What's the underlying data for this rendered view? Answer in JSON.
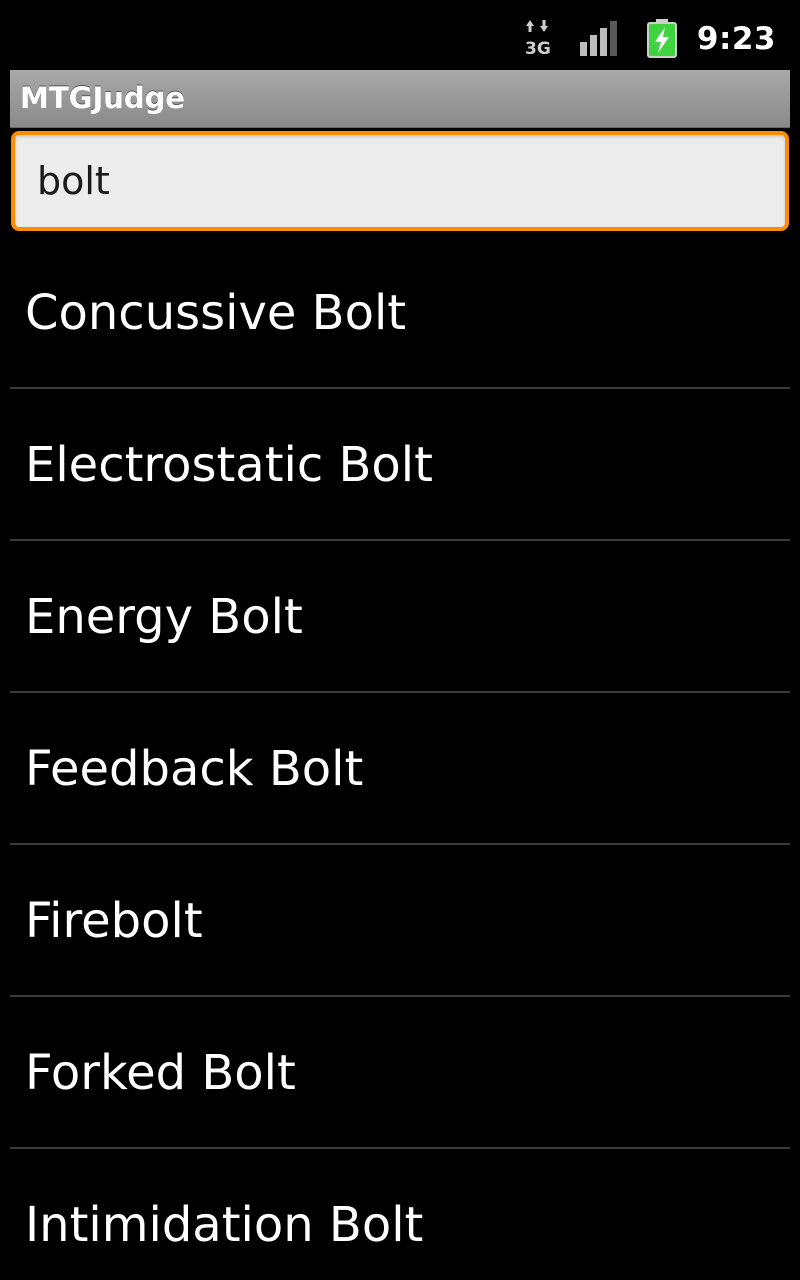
{
  "status_bar": {
    "time": "9:23",
    "network_type": "3G",
    "icons": [
      "data-3g-icon",
      "signal-icon",
      "battery-charging-icon"
    ],
    "battery_color": "#3fd43f"
  },
  "title_bar": {
    "title": "MTGJudge"
  },
  "search": {
    "value": "bolt",
    "accent_color": "#ff8c00"
  },
  "results": [
    {
      "label": "Concussive Bolt"
    },
    {
      "label": "Electrostatic Bolt"
    },
    {
      "label": "Energy Bolt"
    },
    {
      "label": "Feedback Bolt"
    },
    {
      "label": "Firebolt"
    },
    {
      "label": "Forked Bolt"
    },
    {
      "label": "Intimidation Bolt"
    }
  ]
}
